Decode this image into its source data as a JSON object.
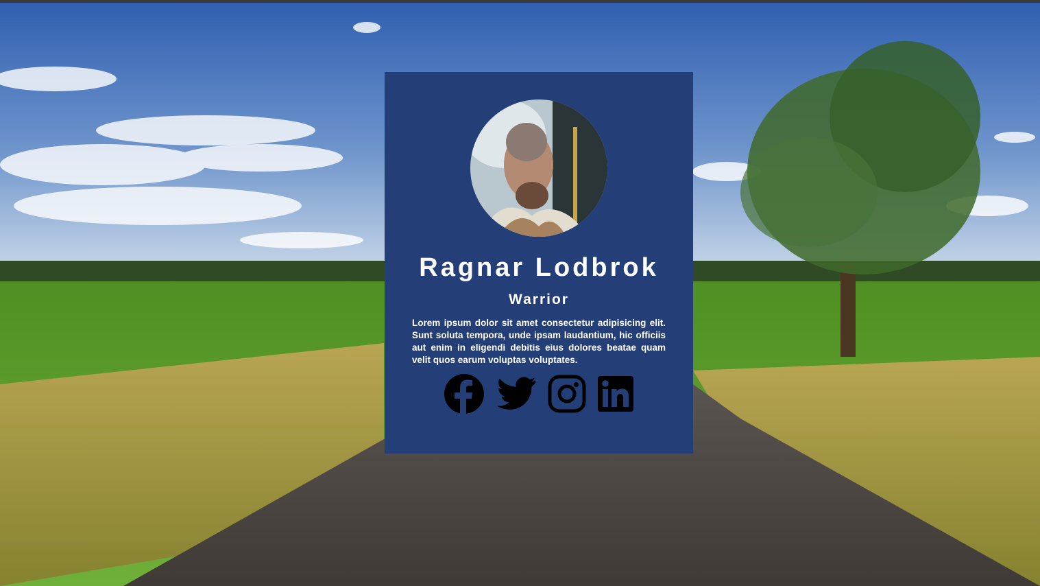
{
  "profile": {
    "name": "Ragnar Lodbrok",
    "role": "Warrior",
    "bio": "Lorem ipsum dolor sit amet consectetur adipisicing elit. Sunt soluta tempora, unde ipsam laudantium, hic officiis aut enim in eligendi debitis eius dolores beatae quam velit quos earum voluptas voluptates."
  },
  "socials": [
    {
      "icon": "facebook-icon"
    },
    {
      "icon": "twitter-icon"
    },
    {
      "icon": "instagram-icon"
    },
    {
      "icon": "linkedin-icon"
    }
  ],
  "colors": {
    "card_background": "#243f77",
    "text": "#ffffff",
    "icon": "#000000",
    "sky": "#3f6fb8",
    "grass": "#5a9a2e",
    "road": "#4a4541"
  }
}
